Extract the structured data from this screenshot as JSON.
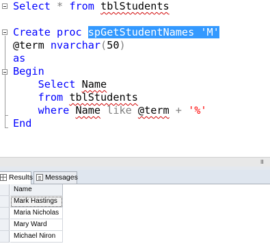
{
  "editor": {
    "line1": {
      "kw1": "Select",
      "star": " * ",
      "kw2": "from",
      "space": " ",
      "table": "tblStudents"
    },
    "line3": {
      "kw1": "Create",
      "space1": " ",
      "kw2": "proc",
      "space2": " ",
      "selected": "spGetStudentNames 'M'"
    },
    "line4": {
      "param": "@term",
      "space": " ",
      "type": "nvarchar",
      "open": "(",
      "len": "50",
      "close": ")"
    },
    "line5": {
      "kw": "as"
    },
    "line6": {
      "kw": "Begin"
    },
    "line7": {
      "indent": "    ",
      "kw": "Select",
      "space": " ",
      "col": "Name"
    },
    "line8": {
      "indent": "    ",
      "kw": "from",
      "space": " ",
      "table": "tblStudents"
    },
    "line9": {
      "indent": "    ",
      "kw": "where",
      "space": " ",
      "col": "Name",
      "space2": " ",
      "op": "like",
      "space3": " ",
      "param": "@term",
      "plus": " + ",
      "str": "'%'"
    },
    "line10": {
      "kw": "End"
    }
  },
  "scrollbar": {
    "grip": "III"
  },
  "results": {
    "tabs": [
      {
        "label": "Results"
      },
      {
        "label": "Messages"
      }
    ],
    "column_header": "Name",
    "rows": [
      "Mark Hastings",
      "Maria Nicholas",
      "Mary Ward",
      "Michael Niron"
    ]
  }
}
